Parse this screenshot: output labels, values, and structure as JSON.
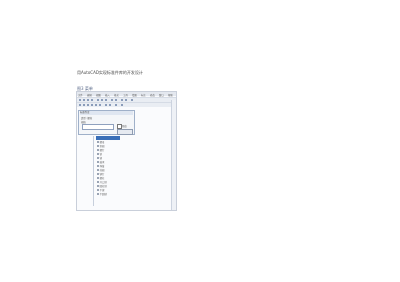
{
  "document": {
    "heading": "用AutoCAD实现标准件库的开发设计",
    "section_label": "图3 菜单"
  },
  "window": {
    "menu": [
      "文件",
      "编辑",
      "视图",
      "插入",
      "格式",
      "工具",
      "绘图",
      "标注",
      "修改",
      "窗口",
      "帮助"
    ],
    "toolbar_rows": 2
  },
  "dialog": {
    "title": "标准件库",
    "row1": "类型: 螺栓",
    "row2": "规格",
    "input_value": "",
    "checkbox_label": "预览",
    "ok_label": "确定"
  },
  "tree": {
    "selected": "螺栓",
    "items": [
      "螺母",
      "垫圈",
      "螺钉",
      "销",
      "键",
      "轴承",
      "弹簧",
      "挡圈",
      "铆钉",
      "螺柱",
      "开口销",
      "圆柱销",
      "平键",
      "半圆键"
    ]
  }
}
